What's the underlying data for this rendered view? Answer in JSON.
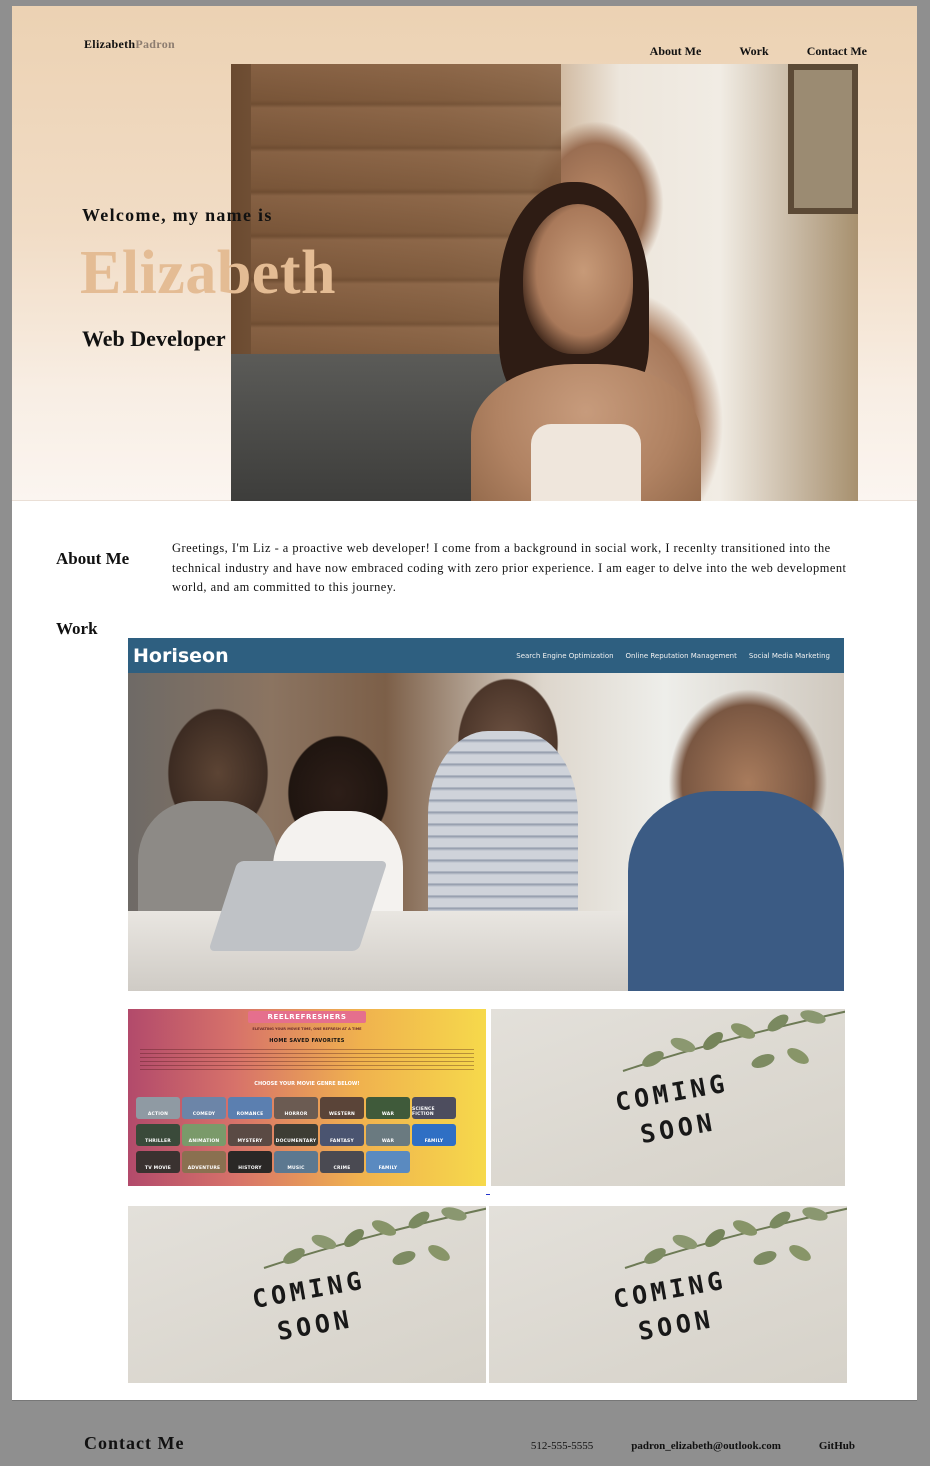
{
  "brand": {
    "first": "Elizabeth",
    "last": "Padron"
  },
  "nav": [
    {
      "label": "About Me"
    },
    {
      "label": "Work"
    },
    {
      "label": "Contact Me"
    }
  ],
  "hero": {
    "welcome": "Welcome, my name is",
    "name": "Elizabeth",
    "role": "Web Developer"
  },
  "about": {
    "heading": "About Me",
    "text": "Greetings, I'm Liz - a proactive web developer! I come from a background in social work, I recenlty transitioned into the technical industry and have now embraced coding with zero prior experience. I am eager to delve into the web development world, and am committed to this journey."
  },
  "work": {
    "heading": "Work",
    "featured": {
      "logo": "Horiseon",
      "links": [
        "Search Engine Optimization",
        "Online Reputation Management",
        "Social Media Marketing"
      ]
    },
    "reel": {
      "title": "REELREFRESHERS",
      "subtitle": "ELEVATING YOUR MOVIE TIME, ONE REFRESH AT A TIME",
      "nav": "HOME   SAVED FAVORITES",
      "choose": "CHOOSE YOUR MOVIE GENRE BELOW!",
      "genres": [
        "ACTION",
        "COMEDY",
        "ROMANCE",
        "HORROR",
        "WESTERN",
        "WAR",
        "SCIENCE FICTION",
        "THRILLER",
        "ANIMATION",
        "MYSTERY",
        "DOCUMENTARY",
        "FANTASY",
        "WAR",
        "FAMILY",
        "TV MOVIE",
        "ADVENTURE",
        "HISTORY",
        "MUSIC",
        "CRIME",
        "FAMILY"
      ]
    },
    "coming_soon": {
      "line1": "COMING",
      "line2": "SOON"
    }
  },
  "footer": {
    "title": "Contact Me",
    "phone": "512-555-5555",
    "email": "padron_elizabeth@outlook.com",
    "github": "GitHub"
  },
  "colors": {
    "hero_accent": "#e4bc94",
    "horiseon_bar": "#2e5f80",
    "footer_bg": "#8f8f8f"
  }
}
